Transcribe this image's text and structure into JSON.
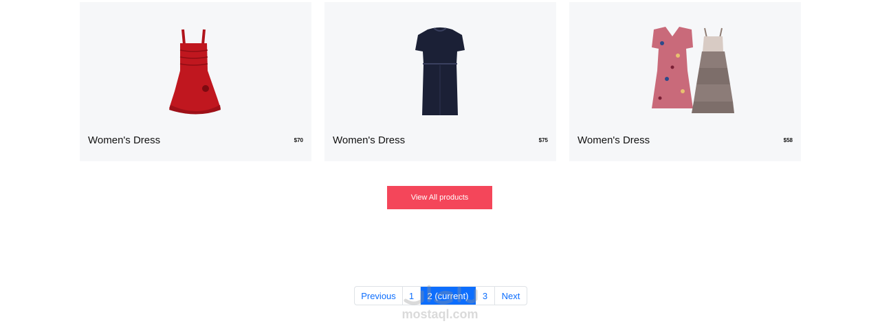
{
  "products": [
    {
      "name": "Women's Dress",
      "price": "$70",
      "image": "red-dress-icon"
    },
    {
      "name": "Women's Dress",
      "price": "$75",
      "image": "navy-dress-icon"
    },
    {
      "name": "Women's Dress",
      "price": "$58",
      "image": "floral-and-tiered-dresses-icon"
    }
  ],
  "view_all_label": "View All products",
  "pagination": {
    "previous": "Previous",
    "pages": [
      "1",
      "2 (current)",
      "3"
    ],
    "current": "2 (current)",
    "next": "Next"
  },
  "watermark": "mostaql.com",
  "colors": {
    "card_bg": "#f6f7f9",
    "button_bg": "#f4465a",
    "link": "#0d6efd"
  }
}
